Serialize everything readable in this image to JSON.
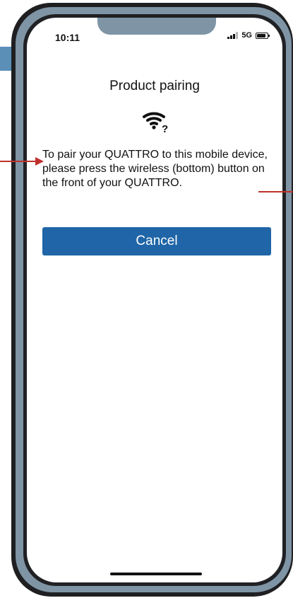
{
  "status_bar": {
    "time": "10:11",
    "network": "5G"
  },
  "header": {
    "title": "Product pairing"
  },
  "icon": {
    "name": "wifi-question-icon"
  },
  "main": {
    "message": "To pair your QUATTRO to this mobile device, please press the wireless (bottom) button on the front of your QUATTRO."
  },
  "actions": {
    "cancel_label": "Cancel"
  },
  "colors": {
    "button": "#1f65a8",
    "bezel": "#7f95a6",
    "annotation": "#c0312c"
  }
}
